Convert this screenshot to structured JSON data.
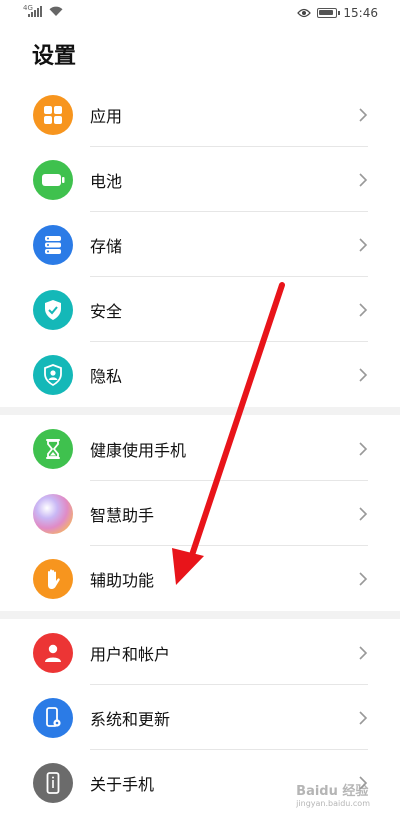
{
  "status_bar": {
    "network": "4G",
    "time": "15:46"
  },
  "page_title": "设置",
  "groups": [
    {
      "items": [
        {
          "label": "应用",
          "icon": "apps-grid-icon",
          "color": "#f7951e"
        },
        {
          "label": "电池",
          "icon": "battery-icon",
          "color": "#3fc14e"
        },
        {
          "label": "存储",
          "icon": "storage-icon",
          "color": "#2b7be6"
        },
        {
          "label": "安全",
          "icon": "shield-check-icon",
          "color": "#14b8b8"
        },
        {
          "label": "隐私",
          "icon": "privacy-shield-icon",
          "color": "#14b8b8"
        }
      ]
    },
    {
      "items": [
        {
          "label": "健康使用手机",
          "icon": "hourglass-icon",
          "color": "#3fc14e"
        },
        {
          "label": "智慧助手",
          "icon": "smart-assistant-icon",
          "color": "#e08bc6"
        },
        {
          "label": "辅助功能",
          "icon": "hand-icon",
          "color": "#f7951e"
        }
      ]
    },
    {
      "items": [
        {
          "label": "用户和帐户",
          "icon": "user-icon",
          "color": "#ec3535"
        },
        {
          "label": "系统和更新",
          "icon": "phone-settings-icon",
          "color": "#2b7be6"
        },
        {
          "label": "关于手机",
          "icon": "phone-info-icon",
          "color": "#6b6b6b"
        }
      ]
    }
  ],
  "annotation": {
    "color": "#e8141a"
  },
  "watermark": {
    "main": "Baidu 经验",
    "sub": "jingyan.baidu.com"
  }
}
